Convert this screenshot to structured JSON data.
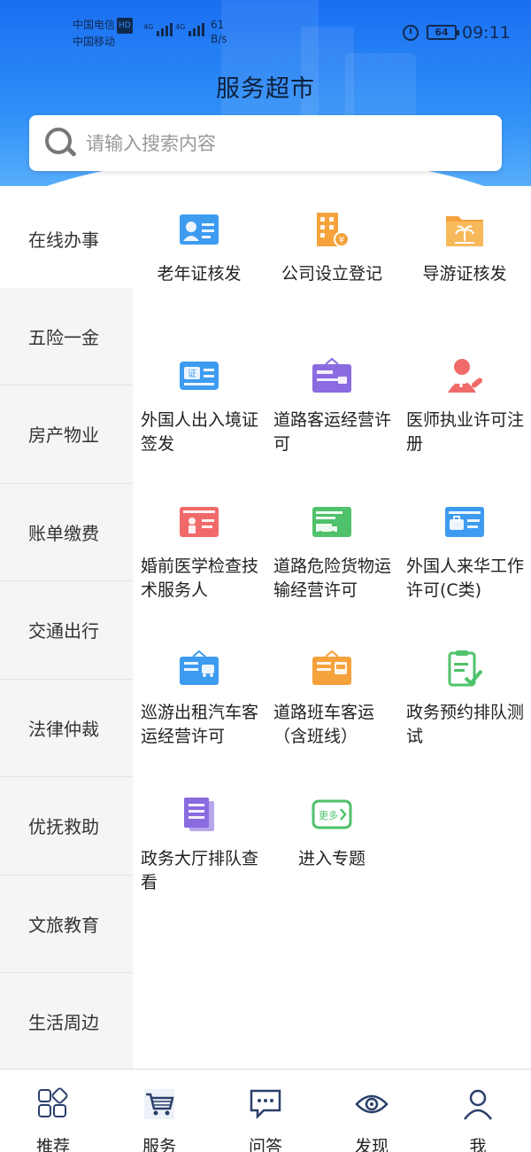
{
  "status": {
    "carrier1": "中国电信",
    "carrier1_badge": "HD",
    "carrier2": "中国移动",
    "net1": "4G",
    "net2": "4G",
    "speed_value": "61",
    "speed_unit": "B/s",
    "battery": "64",
    "time": "09:11"
  },
  "header": {
    "title": "服务超市"
  },
  "search": {
    "placeholder": "请输入搜索内容",
    "icon": "search-icon"
  },
  "sidebar": {
    "active_index": 0,
    "items": [
      {
        "label": "在线办事"
      },
      {
        "label": "五险一金"
      },
      {
        "label": "房产物业"
      },
      {
        "label": "账单缴费"
      },
      {
        "label": "交通出行"
      },
      {
        "label": "法律仲裁"
      },
      {
        "label": "优抚救助"
      },
      {
        "label": "文旅教育"
      },
      {
        "label": "生活周边"
      }
    ]
  },
  "services": [
    {
      "label": "老年证核发",
      "icon": "id-card-icon",
      "color": "#3d9bf0"
    },
    {
      "label": "公司设立登记",
      "icon": "building-icon",
      "color": "#f5a23c"
    },
    {
      "label": "导游证核发",
      "icon": "folder-palm-icon",
      "color": "#f5a23c"
    },
    {
      "label": "外国人出入境证签发",
      "icon": "certificate-icon",
      "color": "#3d9bf0"
    },
    {
      "label": "道路客运经营许可",
      "icon": "sign-board-icon",
      "color": "#8a6be0"
    },
    {
      "label": "医师执业许可注册",
      "icon": "doctor-icon",
      "color": "#f06a6a"
    },
    {
      "label": "婚前医学检查技术服务人",
      "icon": "person-card-icon",
      "color": "#f06a6a"
    },
    {
      "label": "道路危险货物运输经营许可",
      "icon": "truck-card-icon",
      "color": "#4fc26b"
    },
    {
      "label": "外国人来华工作许可(C类)",
      "icon": "briefcase-card-icon",
      "color": "#3d9bf0"
    },
    {
      "label": "巡游出租汽车客运经营许可",
      "icon": "taxi-sign-icon",
      "color": "#3d9bf0"
    },
    {
      "label": "道路班车客运（含班线）",
      "icon": "bus-sign-icon",
      "color": "#f5a23c"
    },
    {
      "label": "政务预约排队测试",
      "icon": "clipboard-check-icon",
      "color": "#4fc26b"
    },
    {
      "label": "政务大厅排队查看",
      "icon": "document-icon",
      "color": "#8a6be0"
    },
    {
      "label": "进入专题",
      "icon": "more-icon",
      "color": "#4fc26b",
      "badge": "更多"
    }
  ],
  "bottom_nav": [
    {
      "label": "推荐",
      "icon": "grid-icon"
    },
    {
      "label": "服务",
      "icon": "cart-icon"
    },
    {
      "label": "问答",
      "icon": "chat-icon"
    },
    {
      "label": "发现",
      "icon": "eye-icon"
    },
    {
      "label": "我",
      "icon": "user-icon"
    }
  ]
}
